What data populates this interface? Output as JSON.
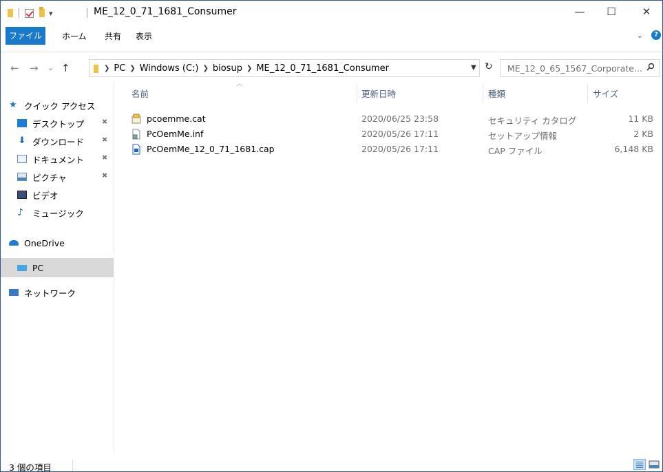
{
  "window": {
    "title": "ME_12_0_71_1681_Consumer",
    "minimize": "—",
    "maximize": "☐",
    "close": "✕"
  },
  "ribbon": {
    "tabs": [
      {
        "label": "ファイル"
      },
      {
        "label": "ホーム"
      },
      {
        "label": "共有"
      },
      {
        "label": "表示"
      }
    ],
    "help": "?"
  },
  "address": {
    "back": "←",
    "forward": "→",
    "recent": "⌄",
    "up": "↑",
    "crumbs": [
      "PC",
      "Windows (C:)",
      "biosup",
      "ME_12_0_71_1681_Consumer"
    ],
    "search_placeholder": "ME_12_0_65_1567_Corporate..."
  },
  "nav": {
    "quick_access": "クイック アクセス",
    "items": [
      {
        "label": "デスクトップ"
      },
      {
        "label": "ダウンロード"
      },
      {
        "label": "ドキュメント"
      },
      {
        "label": "ピクチャ"
      },
      {
        "label": "ビデオ"
      },
      {
        "label": "ミュージック"
      }
    ],
    "onedrive": "OneDrive",
    "pc": "PC",
    "network": "ネットワーク"
  },
  "columns": {
    "name": "名前",
    "date": "更新日時",
    "type": "種類",
    "size": "サイズ"
  },
  "files": [
    {
      "name": "pcoemme.cat",
      "date": "2020/06/25 23:58",
      "type": "セキュリティ カタログ",
      "size": "11 KB"
    },
    {
      "name": "PcOemMe.inf",
      "date": "2020/05/26 17:11",
      "type": "セットアップ情報",
      "size": "2 KB"
    },
    {
      "name": "PcOemMe_12_0_71_1681.cap",
      "date": "2020/05/26 17:11",
      "type": "CAP ファイル",
      "size": "6,148 KB"
    }
  ],
  "status": {
    "count": "3 個の項目"
  },
  "colors": {
    "accent": "#1979ca",
    "folder": "#f0c24a",
    "selected": "#d9d9d9"
  }
}
